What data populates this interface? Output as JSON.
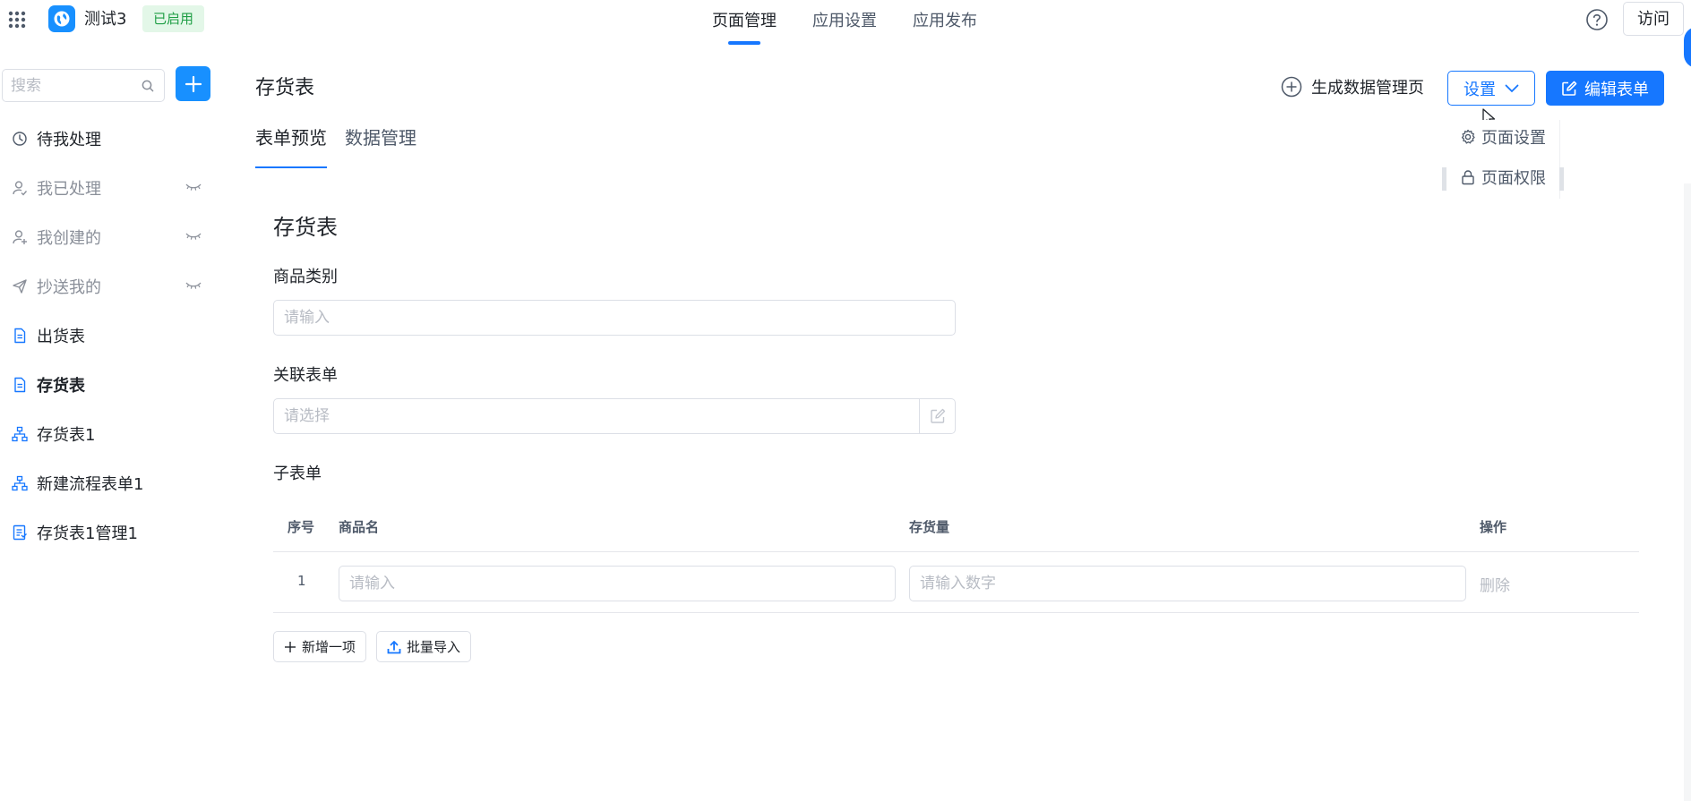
{
  "app": {
    "name": "测试3",
    "status": "已启用"
  },
  "top_nav": {
    "tabs": [
      {
        "label": "页面管理"
      },
      {
        "label": "应用设置"
      },
      {
        "label": "应用发布"
      }
    ],
    "visit_label": "访问"
  },
  "sidebar": {
    "search_placeholder": "搜索",
    "items": [
      {
        "label": "待我处理",
        "icon": "clock-icon"
      },
      {
        "label": "我已处理",
        "icon": "user-check-icon",
        "hidden": true
      },
      {
        "label": "我创建的",
        "icon": "user-add-icon",
        "hidden": true
      },
      {
        "label": "抄送我的",
        "icon": "send-icon",
        "hidden": true
      },
      {
        "label": "出货表",
        "icon": "document-icon"
      },
      {
        "label": "存货表",
        "icon": "document-icon",
        "selected": true
      },
      {
        "label": "存货表1",
        "icon": "workflow-icon"
      },
      {
        "label": "新建流程表单1",
        "icon": "workflow-icon"
      },
      {
        "label": "存货表1管理1",
        "icon": "report-icon"
      }
    ]
  },
  "header": {
    "title": "存货表",
    "generate_label": "生成数据管理页",
    "settings_label": "设置",
    "edit_label": "编辑表单",
    "dropdown": {
      "items": [
        {
          "label": "页面设置",
          "icon": "gear-icon"
        },
        {
          "label": "页面权限",
          "icon": "lock-icon"
        }
      ]
    }
  },
  "sub_tabs": [
    {
      "label": "表单预览"
    },
    {
      "label": "数据管理"
    }
  ],
  "form": {
    "title": "存货表",
    "category": {
      "label": "商品类别",
      "placeholder": "请输入"
    },
    "linked_form": {
      "label": "关联表单",
      "placeholder": "请选择"
    },
    "subform": {
      "label": "子表单",
      "columns": {
        "index": "序号",
        "name": "商品名",
        "stock": "存货量",
        "action": "操作"
      },
      "rows": [
        {
          "index": "1",
          "name_placeholder": "请输入",
          "stock_placeholder": "请输入数字",
          "delete_label": "删除"
        }
      ],
      "add_label": "新增一项",
      "import_label": "批量导入"
    }
  },
  "colors": {
    "primary": "#1677ff",
    "success_bg": "#e3f7e8",
    "success_text": "#1f9e45"
  }
}
